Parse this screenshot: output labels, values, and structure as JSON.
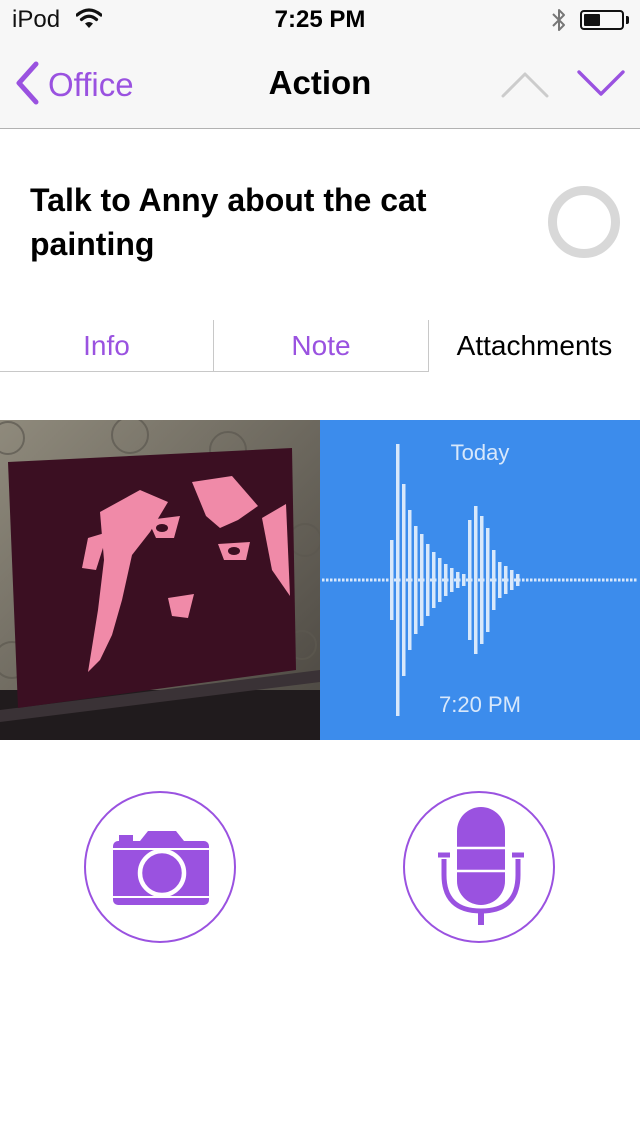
{
  "status_bar": {
    "carrier": "iPod",
    "time": "7:25 PM",
    "battery_level": 0.45
  },
  "nav": {
    "back_label": "Office",
    "title": "Action"
  },
  "task": {
    "title": "Talk to Anny about the cat painting"
  },
  "tabs": [
    {
      "label": "Info",
      "selected": false
    },
    {
      "label": "Note",
      "selected": false
    },
    {
      "label": "Attachments",
      "selected": true
    }
  ],
  "attachments": {
    "photo": {
      "subject": "pink cat painting on canvas"
    },
    "audio": {
      "date": "Today",
      "time": "7:20 PM"
    }
  },
  "colors": {
    "accent": "#9a52e0",
    "audio_tile": "#3c8cec",
    "checkbox": "#d8d8d8"
  },
  "icons": [
    "back-chevron-icon",
    "up-chevron-icon",
    "down-chevron-icon",
    "wifi-icon",
    "bluetooth-icon",
    "battery-icon",
    "camera-icon",
    "microphone-icon"
  ]
}
